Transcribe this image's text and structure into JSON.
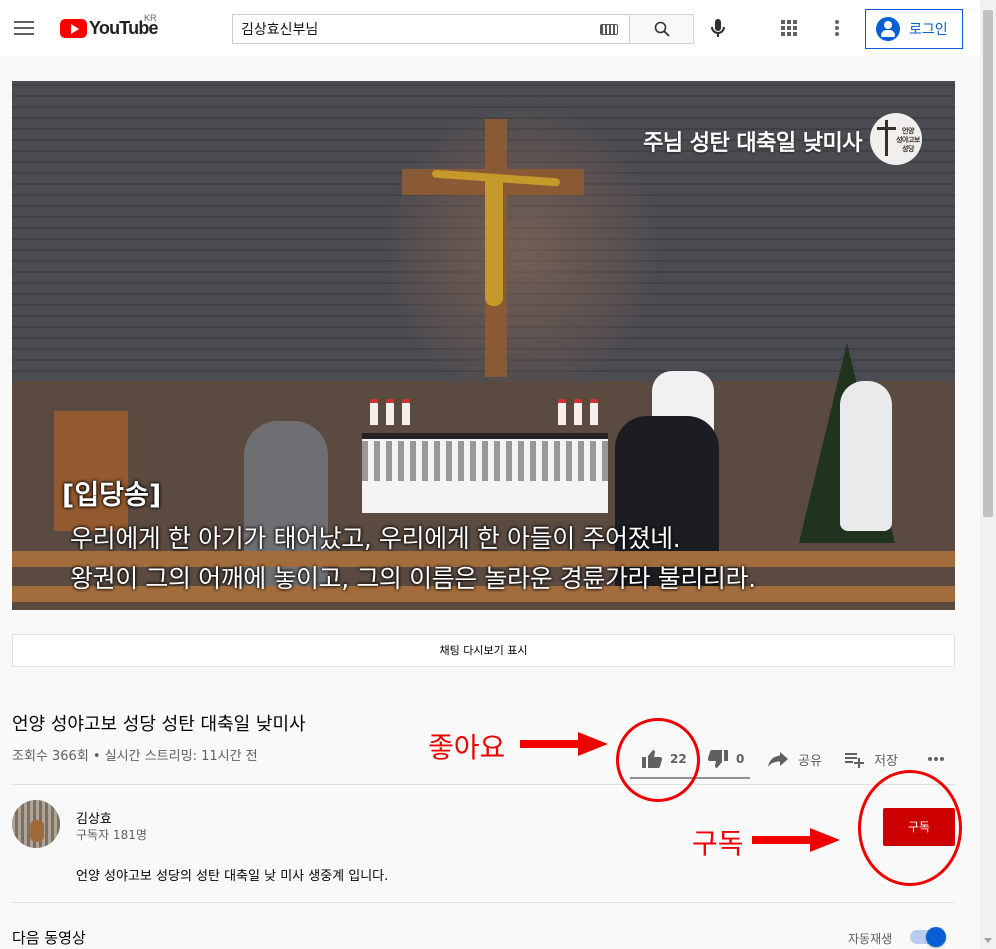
{
  "header": {
    "logo_text": "YouTube",
    "logo_region": "KR",
    "search_value": "김상효신부님",
    "login_label": "로그인"
  },
  "video": {
    "overlay_title": "주님 성탄 대축일 낮미사",
    "overlay_logo_text": "언양\n성야고보\n성당",
    "caption_label": "[입당송]",
    "caption_line1": "우리에게 한 아기가 태어났고, 우리에게 한 아들이 주어졌네.",
    "caption_line2": "왕권이 그의 어깨에 놓이고, 그의 이름은 놀라운 경륜가라 불리리라."
  },
  "chat_replay_label": "채팅 다시보기 표시",
  "info": {
    "title": "언양 성야고보 성당 성탄 대축일 낮미사",
    "meta": "조회수 366회 • 실시간 스트리밍: 11시간 전",
    "like_count": "22",
    "dislike_count": "0",
    "share_label": "공유",
    "save_label": "저장"
  },
  "channel": {
    "name": "김상효",
    "subscribers": "구독자 181명",
    "subscribe_label": "구독",
    "description": "언양 성야고보 성당의  성탄 대축일 낮 미사  생중계 입니다."
  },
  "up_next": {
    "label": "다음 동영상",
    "autoplay_label": "자동재생",
    "autoplay_on": true
  },
  "annotations": {
    "like_note": "좋아요",
    "subscribe_note": "구독",
    "color": "#ee0000"
  },
  "colors": {
    "brand_red": "#ff0000",
    "subscribe_red": "#cc0000",
    "link_blue": "#065fd4"
  }
}
